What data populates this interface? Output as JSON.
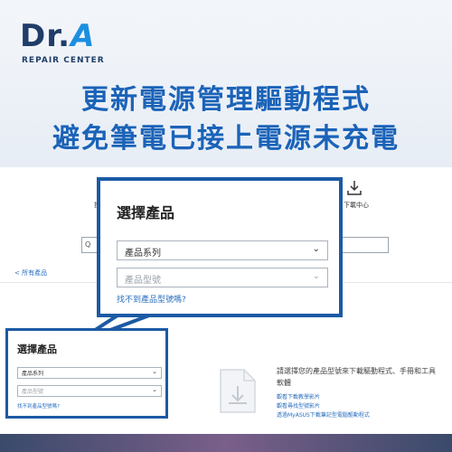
{
  "brand": {
    "logo_main": "Dr.",
    "logo_letter": "A",
    "logo_sub": "REPAIR CENTER"
  },
  "headline": {
    "line1": "更新電源管理驅動程式",
    "line2": "避免筆電已接上電源未充電"
  },
  "page": {
    "download_label": "下載中心",
    "left_small_text": "搜",
    "search_placeholder": "Q",
    "breadcrumb": "< 所有產品"
  },
  "popup": {
    "title": "選擇產品",
    "series_label": "產品系列",
    "model_label": "產品型號",
    "link_text": "找不到產品型號嗎?"
  },
  "small_panel": {
    "title": "選擇產品",
    "series_label": "產品系列",
    "model_label": "產品型號",
    "link_text": "找不到產品型號嗎?"
  },
  "info": {
    "text": "請選擇您的產品型號來下載驅動程式、手冊和工具軟體",
    "link1": "觀看下載教學影片",
    "link2": "觀看尋找型號影片",
    "link3": "透過MyASUS下載筆記型電腦驅動程式"
  },
  "colors": {
    "accent": "#1c5aa5",
    "title": "#1b63b8",
    "link": "#2a6fbf"
  }
}
